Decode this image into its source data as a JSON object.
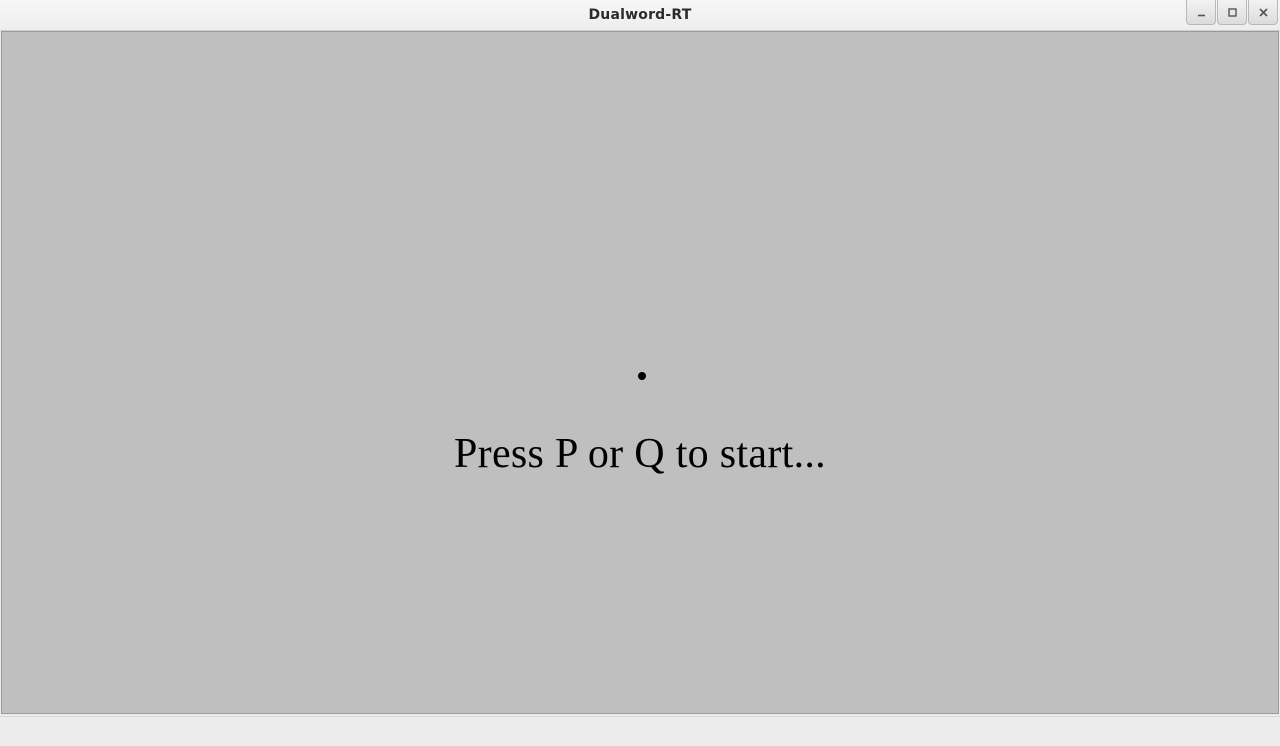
{
  "titlebar": {
    "title": "Dualword-RT"
  },
  "content": {
    "instruction": "Press P or Q to start..."
  }
}
